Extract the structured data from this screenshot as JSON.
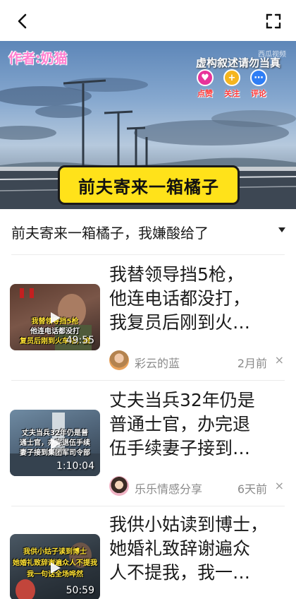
{
  "topbar": {
    "back_icon": "back-arrow-icon",
    "fullscreen_icon": "fullscreen-icon"
  },
  "video": {
    "author_tag": "作者:奶猫",
    "disclaimer": "虚构叙述请勿当真",
    "watermark": "西瓜视频",
    "actions": [
      {
        "label": "点赞",
        "icon": "heart-icon",
        "color": "#e8339a"
      },
      {
        "label": "关注",
        "icon": "plus-icon",
        "color": "#f5b51f"
      },
      {
        "label": "评论",
        "icon": "comment-icon",
        "color": "#2f7ef5"
      }
    ],
    "caption": "前夫寄来一箱橘子"
  },
  "title": {
    "text": "前夫寄来一箱橘子，我嫌酸给了"
  },
  "feed": [
    {
      "title_lines": [
        "我替领导挡5枪，",
        "他连电话都没打，",
        "我复员后刚到火…"
      ],
      "duration": "49:55",
      "thumb_overlay": [
        "我替领导挡5枪",
        "他连电话都没打",
        "复员后刚到火车站，接"
      ],
      "author": "彩云的蓝",
      "time": "2月前",
      "close": "×"
    },
    {
      "title_lines": [
        "丈夫当兵32年仍是",
        "普通士官，办完退",
        "伍手续妻子接到…"
      ],
      "duration": "1:10:04",
      "thumb_overlay": [
        "丈夫当兵32年仍是普",
        "通士官，办完退伍手续",
        "妻子接到集团军司令部"
      ],
      "author": "乐乐情感分享",
      "time": "6天前",
      "close": "×"
    },
    {
      "title_lines": [
        "我供小姑读到博士，",
        "她婚礼致辞谢遍众",
        "人不提我，我一…"
      ],
      "duration": "50:59",
      "thumb_overlay": [
        "我供小姑子读到博士",
        "她婚礼致辞谢遍众人不提我",
        "我一句话全场哗然"
      ],
      "author": "",
      "time": "",
      "close": ""
    }
  ]
}
